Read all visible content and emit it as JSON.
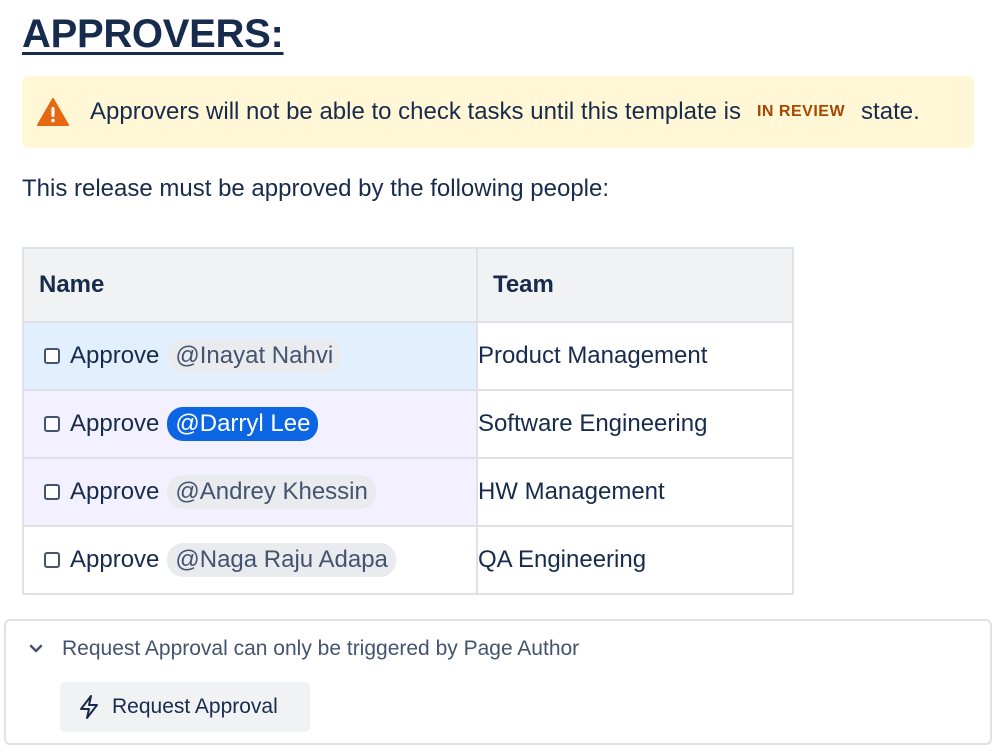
{
  "heading": "APPROVERS:",
  "warning": {
    "icon": "warning-icon",
    "text_before": "Approvers will not be able to check tasks until this template is",
    "lozenge": "IN REVIEW",
    "text_after": "state.",
    "lozenge_color": "#a54800",
    "background": "#fff7d6",
    "icon_color": "#e56910"
  },
  "intro": "This release must be approved by the following people:",
  "table": {
    "headers": [
      "Name",
      "Team"
    ],
    "rows": [
      {
        "action": "Approve",
        "mention": "@Inayat Nahvi",
        "team": "Product Management",
        "checked": false
      },
      {
        "action": "Approve",
        "mention": "@Darryl Lee",
        "team": "Software Engineering",
        "checked": false
      },
      {
        "action": "Approve",
        "mention": "@Andrey Khessin",
        "team": "HW Management",
        "checked": false
      },
      {
        "action": "Approve",
        "mention": "@Naga Raju Adapa",
        "team": "QA Engineering",
        "checked": false
      }
    ]
  },
  "panel": {
    "header": "Request Approval can only be triggered by Page Author",
    "button_label": "Request Approval",
    "chevron_icon": "chevron-down-icon",
    "button_icon": "lightning-bolt-icon"
  },
  "colors": {
    "text": "#172b4d",
    "mention_self_bg": "#0c66e4",
    "row_highlight_blue": "#e1efff",
    "row_highlight_purple": "#f3f0ff"
  }
}
